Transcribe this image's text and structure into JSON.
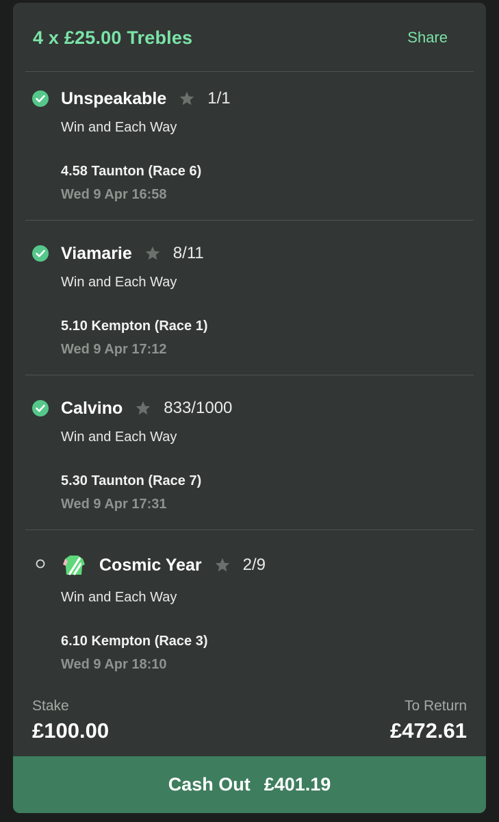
{
  "bet": {
    "title": "4 x £25.00 Trebles",
    "share_label": "Share"
  },
  "selections": [
    {
      "name": "Unspeakable",
      "odds": "1/1",
      "market": "Win and Each Way",
      "race": "4.58 Taunton (Race 6)",
      "time": "Wed 9 Apr 16:58",
      "status": "won"
    },
    {
      "name": "Viamarie",
      "odds": "8/11",
      "market": "Win and Each Way",
      "race": "5.10 Kempton (Race 1)",
      "time": "Wed 9 Apr 17:12",
      "status": "won"
    },
    {
      "name": "Calvino",
      "odds": "833/1000",
      "market": "Win and Each Way",
      "race": "5.30 Taunton (Race 7)",
      "time": "Wed 9 Apr 17:31",
      "status": "won"
    },
    {
      "name": "Cosmic Year",
      "odds": "2/9",
      "market": "Win and Each Way",
      "race": "6.10 Kempton (Race 3)",
      "time": "Wed 9 Apr 18:10",
      "status": "pending"
    }
  ],
  "footer": {
    "stake_label": "Stake",
    "stake_value": "£100.00",
    "return_label": "To Return",
    "return_value": "£472.61"
  },
  "cashout": {
    "label": "Cash Out",
    "amount": "£401.19"
  },
  "icons": {
    "won": "check-circle-icon",
    "pending": "empty-circle-icon",
    "favourite": "star-icon",
    "silks": "jockey-silks-icon"
  },
  "colors": {
    "accent": "#7be3a8",
    "card_bg": "#323634",
    "cashout_bg": "#3e7d5e",
    "check": "#55c78a"
  }
}
